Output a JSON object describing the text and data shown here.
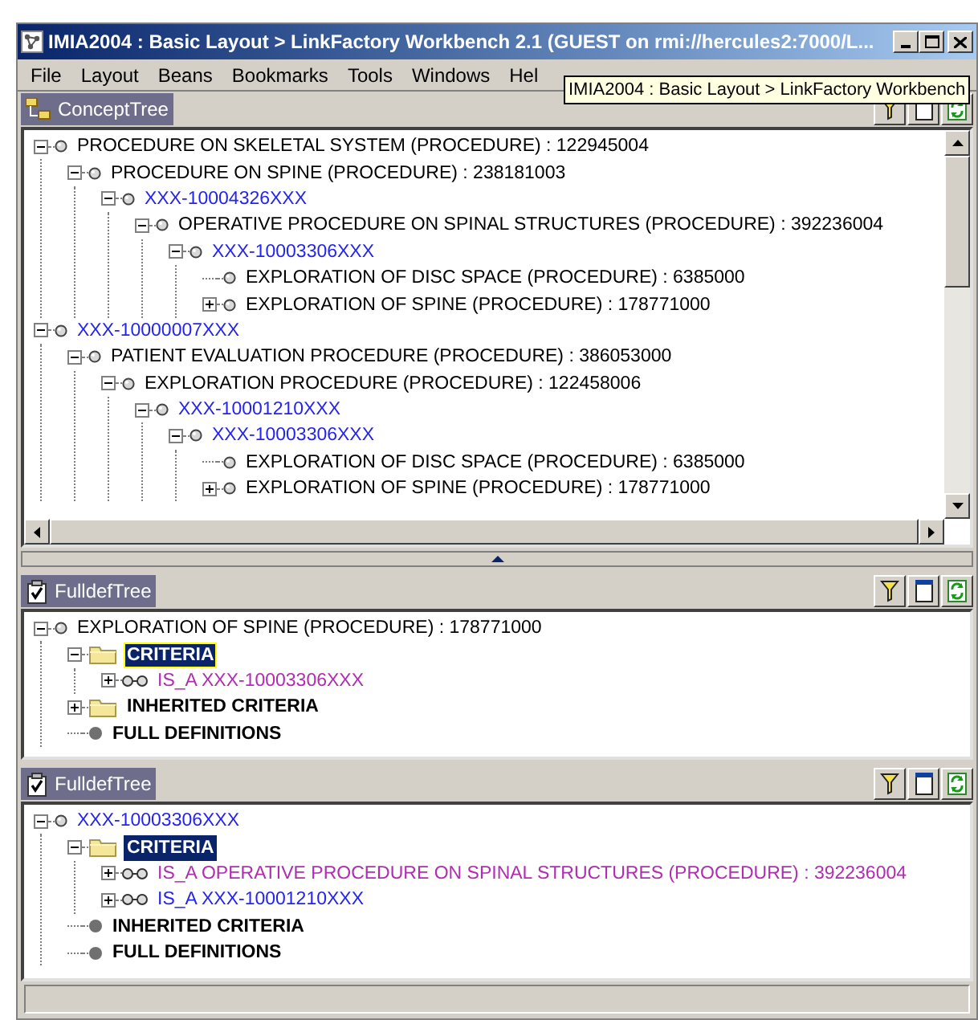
{
  "window": {
    "title": "IMIA2004 : Basic Layout > LinkFactory Workbench 2.1 (GUEST on rmi://hercules2:7000/L..."
  },
  "menu": [
    "File",
    "Layout",
    "Beans",
    "Bookmarks",
    "Tools",
    "Windows",
    "Hel"
  ],
  "tooltip": "IMIA2004 : Basic Layout > LinkFactory Workbench",
  "panels": [
    {
      "title": "ConceptTree",
      "kind": "concept",
      "focused": false,
      "tree": [
        {
          "label": "PROCEDURE ON SKELETAL SYSTEM (PROCEDURE) : 122945004",
          "kind": "concept",
          "color": "#000000",
          "expanded": true,
          "selected": false,
          "children": [
            {
              "label": "PROCEDURE ON SPINE (PROCEDURE) : 238181003",
              "kind": "concept",
              "color": "#000000",
              "expanded": true,
              "selected": false,
              "children": [
                {
                  "label": "XXX-10004326XXX",
                  "kind": "concept",
                  "color": "#2424f0",
                  "expanded": true,
                  "selected": false,
                  "children": [
                    {
                      "label": "OPERATIVE PROCEDURE ON SPINAL STRUCTURES (PROCEDURE) : 392236004",
                      "kind": "concept",
                      "color": "#000000",
                      "expanded": true,
                      "selected": false,
                      "children": [
                        {
                          "label": "XXX-10003306XXX",
                          "kind": "concept",
                          "color": "#2424f0",
                          "expanded": true,
                          "selected": false,
                          "children": [
                            {
                              "label": "EXPLORATION OF DISC SPACE (PROCEDURE) : 6385000",
                              "kind": "concept",
                              "color": "#000000",
                              "selected": false
                            },
                            {
                              "label": "EXPLORATION OF SPINE (PROCEDURE) : 178771000",
                              "kind": "concept",
                              "color": "#000000",
                              "expanded": false,
                              "selected": false
                            }
                          ]
                        }
                      ]
                    }
                  ]
                }
              ]
            }
          ]
        },
        {
          "label": "XXX-10000007XXX",
          "kind": "concept",
          "color": "#2424f0",
          "expanded": true,
          "selected": false,
          "children": [
            {
              "label": "PATIENT EVALUATION PROCEDURE (PROCEDURE) : 386053000",
              "kind": "concept",
              "color": "#000000",
              "expanded": true,
              "selected": false,
              "children": [
                {
                  "label": "EXPLORATION PROCEDURE (PROCEDURE) : 122458006",
                  "kind": "concept",
                  "color": "#000000",
                  "expanded": true,
                  "selected": false,
                  "children": [
                    {
                      "label": "XXX-10001210XXX",
                      "kind": "concept",
                      "color": "#2424f0",
                      "expanded": true,
                      "selected": false,
                      "children": [
                        {
                          "label": "XXX-10003306XXX",
                          "kind": "concept",
                          "color": "#2424f0",
                          "expanded": true,
                          "selected": false,
                          "children": [
                            {
                              "label": "EXPLORATION OF DISC SPACE (PROCEDURE) : 6385000",
                              "kind": "concept",
                              "color": "#000000",
                              "selected": false
                            },
                            {
                              "label": "EXPLORATION OF SPINE (PROCEDURE) : 178771000",
                              "kind": "concept",
                              "color": "#000000",
                              "expanded": false,
                              "selected": false
                            }
                          ]
                        }
                      ]
                    }
                  ]
                }
              ]
            }
          ]
        }
      ]
    },
    {
      "title": "FulldefTree",
      "kind": "fulldef",
      "focused": true,
      "tree": [
        {
          "label": "EXPLORATION OF SPINE (PROCEDURE) : 178771000",
          "kind": "concept",
          "color": "#000000",
          "expanded": true,
          "selected": false,
          "children": [
            {
              "label": "CRITERIA",
              "kind": "folder",
              "expanded": true,
              "selected": true,
              "children": [
                {
                  "label": "IS_A XXX-10003306XXX",
                  "kind": "relation",
                  "color": "#b02cb0",
                  "expanded": false,
                  "selected": false
                }
              ]
            },
            {
              "label": "INHERITED CRITERIA",
              "kind": "folder",
              "color": "#000000",
              "expanded": false,
              "selected": false
            },
            {
              "label": "FULL DEFINITIONS",
              "kind": "leaf",
              "color": "#000000",
              "selected": false
            }
          ]
        }
      ]
    },
    {
      "title": "FulldefTree",
      "kind": "fulldef",
      "focused": false,
      "tree": [
        {
          "label": "XXX-10003306XXX",
          "kind": "concept",
          "color": "#2424f0",
          "expanded": true,
          "selected": false,
          "children": [
            {
              "label": "CRITERIA",
              "kind": "folder",
              "expanded": true,
              "selected": true,
              "children": [
                {
                  "label": "IS_A OPERATIVE PROCEDURE ON SPINAL STRUCTURES (PROCEDURE) : 392236004",
                  "kind": "relation",
                  "color": "#b02cb0",
                  "expanded": false,
                  "selected": false
                },
                {
                  "label": "IS_A XXX-10001210XXX",
                  "kind": "relation",
                  "color": "#2424f0",
                  "expanded": false,
                  "selected": false
                }
              ]
            },
            {
              "label": "INHERITED CRITERIA",
              "kind": "leaf",
              "color": "#000000",
              "selected": false
            },
            {
              "label": "FULL DEFINITIONS",
              "kind": "leaf",
              "color": "#000000",
              "selected": false
            }
          ]
        }
      ]
    }
  ]
}
